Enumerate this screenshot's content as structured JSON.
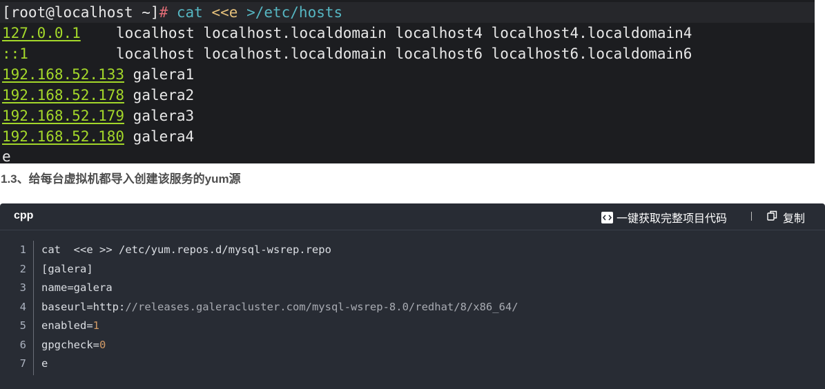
{
  "terminal": {
    "prompt": "[root@localhost ~]",
    "prompt_symbol": "#",
    "cmd_name": "cat",
    "cmd_heredoc": "<<e",
    "cmd_redirect": ">/etc/hosts",
    "hosts": [
      {
        "ip": "127.0.0.1",
        "names": "localhost localhost.localdomain localhost4 localhost4.localdomain4"
      },
      {
        "ip": "::1",
        "names": "localhost localhost.localdomain localhost6 localhost6.localdomain6"
      },
      {
        "ip": "192.168.52.133",
        "names": "galera1"
      },
      {
        "ip": "192.168.52.178",
        "names": "galera2"
      },
      {
        "ip": "192.168.52.179",
        "names": "galera3"
      },
      {
        "ip": "192.168.52.180",
        "names": "galera4"
      }
    ],
    "end_marker": "e"
  },
  "heading": "1.3、给每台虚拟机都导入创建该服务的yum源",
  "code_block": {
    "language": "cpp",
    "copy_all_label": "一键获取完整项目代码",
    "copy_label": "复制",
    "lines": [
      {
        "num": "1",
        "a": "cat  <<e >> /etc/yum.repos.d/mysql-wsrep.repo",
        "b": "",
        "c": ""
      },
      {
        "num": "2",
        "a": "[galera]",
        "b": "",
        "c": ""
      },
      {
        "num": "3",
        "a": "name=galera",
        "b": "",
        "c": ""
      },
      {
        "num": "4",
        "a": "baseurl=http:",
        "b": "//releases.galeracluster.com/mysql-wsrep-8.0/redhat/8/x86_64/",
        "c": ""
      },
      {
        "num": "5",
        "a": "enabled=",
        "b": "",
        "c": "1"
      },
      {
        "num": "6",
        "a": "gpgcheck=",
        "b": "",
        "c": "0"
      },
      {
        "num": "7",
        "a": "e",
        "b": "",
        "c": ""
      }
    ]
  }
}
